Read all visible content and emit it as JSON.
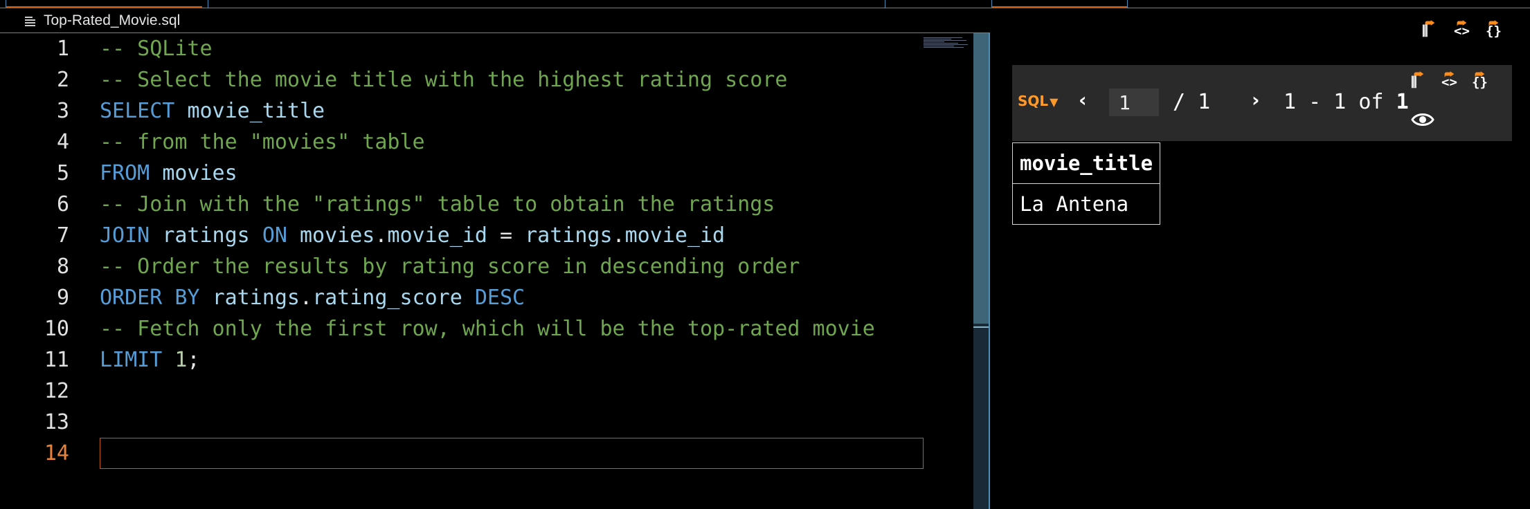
{
  "editor": {
    "file_tab": {
      "filename": "Top-Rated_Movie.sql",
      "icon": "lines-icon"
    },
    "lines": [
      {
        "n": "1",
        "tokens": [
          {
            "t": "-- SQLite",
            "c": "cmt"
          }
        ]
      },
      {
        "n": "2",
        "tokens": [
          {
            "t": "-- Select the movie title with the highest rating score",
            "c": "cmt"
          }
        ]
      },
      {
        "n": "3",
        "tokens": [
          {
            "t": "SELECT",
            "c": "kw"
          },
          {
            "t": " "
          },
          {
            "t": "movie_title",
            "c": "id"
          }
        ]
      },
      {
        "n": "4",
        "tokens": [
          {
            "t": "-- from the \"movies\" table",
            "c": "cmt"
          }
        ]
      },
      {
        "n": "5",
        "tokens": [
          {
            "t": "FROM",
            "c": "kw"
          },
          {
            "t": " "
          },
          {
            "t": "movies",
            "c": "id"
          }
        ]
      },
      {
        "n": "6",
        "tokens": [
          {
            "t": "-- Join with the \"ratings\" table to obtain the ratings",
            "c": "cmt"
          }
        ]
      },
      {
        "n": "7",
        "tokens": [
          {
            "t": "JOIN",
            "c": "kw"
          },
          {
            "t": " "
          },
          {
            "t": "ratings",
            "c": "id"
          },
          {
            "t": " "
          },
          {
            "t": "ON",
            "c": "kw"
          },
          {
            "t": " "
          },
          {
            "t": "movies",
            "c": "id"
          },
          {
            "t": "."
          },
          {
            "t": "movie_id",
            "c": "id"
          },
          {
            "t": " = "
          },
          {
            "t": "ratings",
            "c": "id"
          },
          {
            "t": "."
          },
          {
            "t": "movie_id",
            "c": "id"
          }
        ]
      },
      {
        "n": "8",
        "tokens": [
          {
            "t": "-- Order the results by rating score in descending order",
            "c": "cmt"
          }
        ]
      },
      {
        "n": "9",
        "tokens": [
          {
            "t": "ORDER BY",
            "c": "kw"
          },
          {
            "t": " "
          },
          {
            "t": "ratings",
            "c": "id"
          },
          {
            "t": "."
          },
          {
            "t": "rating_score",
            "c": "id"
          },
          {
            "t": " "
          },
          {
            "t": "DESC",
            "c": "kw"
          }
        ]
      },
      {
        "n": "10",
        "tokens": [
          {
            "t": "-- Fetch only the first row, which will be the top-rated movie",
            "c": "cmt"
          }
        ]
      },
      {
        "n": "11",
        "tokens": [
          {
            "t": "LIMIT",
            "c": "kw"
          },
          {
            "t": " "
          },
          {
            "t": "1",
            "c": "num"
          },
          {
            "t": ";"
          }
        ]
      },
      {
        "n": "12",
        "tokens": []
      },
      {
        "n": "13",
        "tokens": []
      },
      {
        "n": "14",
        "tokens": [],
        "current": true
      }
    ]
  },
  "results": {
    "top_icons": [
      "export-icon",
      "code-icon",
      "json-icon"
    ],
    "toolbar": {
      "engine_label": "SQL",
      "engine_dropdown_icon": "triangle-down-icon",
      "prev_icon": "chevron-left-icon",
      "page_value": "1",
      "page_total": "/ 1",
      "next_icon": "chevron-right-icon",
      "range_prefix": "1 - 1 of ",
      "range_total": "1",
      "icons": [
        "export-icon",
        "code-icon",
        "json-icon"
      ],
      "view_icon": "eye-icon"
    },
    "grid": {
      "columns": [
        "movie_title"
      ],
      "rows": [
        [
          "La Antena"
        ]
      ]
    }
  },
  "colors": {
    "accent": "#c25a15",
    "border": "#4a90b8",
    "comment": "#6fa64f",
    "keyword": "#569cd6",
    "identifier": "#a8d8f0"
  }
}
